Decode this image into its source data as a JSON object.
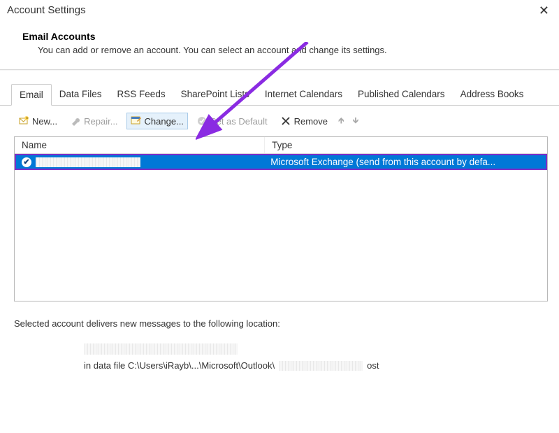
{
  "window": {
    "title": "Account Settings"
  },
  "header": {
    "title": "Email Accounts",
    "subtitle": "You can add or remove an account. You can select an account and change its settings."
  },
  "tabs": [
    {
      "label": "Email",
      "active": true
    },
    {
      "label": "Data Files"
    },
    {
      "label": "RSS Feeds"
    },
    {
      "label": "SharePoint Lists"
    },
    {
      "label": "Internet Calendars"
    },
    {
      "label": "Published Calendars"
    },
    {
      "label": "Address Books"
    }
  ],
  "toolbar": {
    "new": "New...",
    "repair": "Repair...",
    "change": "Change...",
    "set_default": "Set as Default",
    "remove": "Remove"
  },
  "table": {
    "headers": {
      "name": "Name",
      "type": "Type"
    },
    "rows": [
      {
        "type": "Microsoft Exchange (send from this account by defa..."
      }
    ]
  },
  "location": {
    "intro": "Selected account delivers new messages to the following location:",
    "line2_prefix": "in data file C:\\Users\\iRayb\\...\\Microsoft\\Outlook\\",
    "line2_suffix": "ost"
  }
}
